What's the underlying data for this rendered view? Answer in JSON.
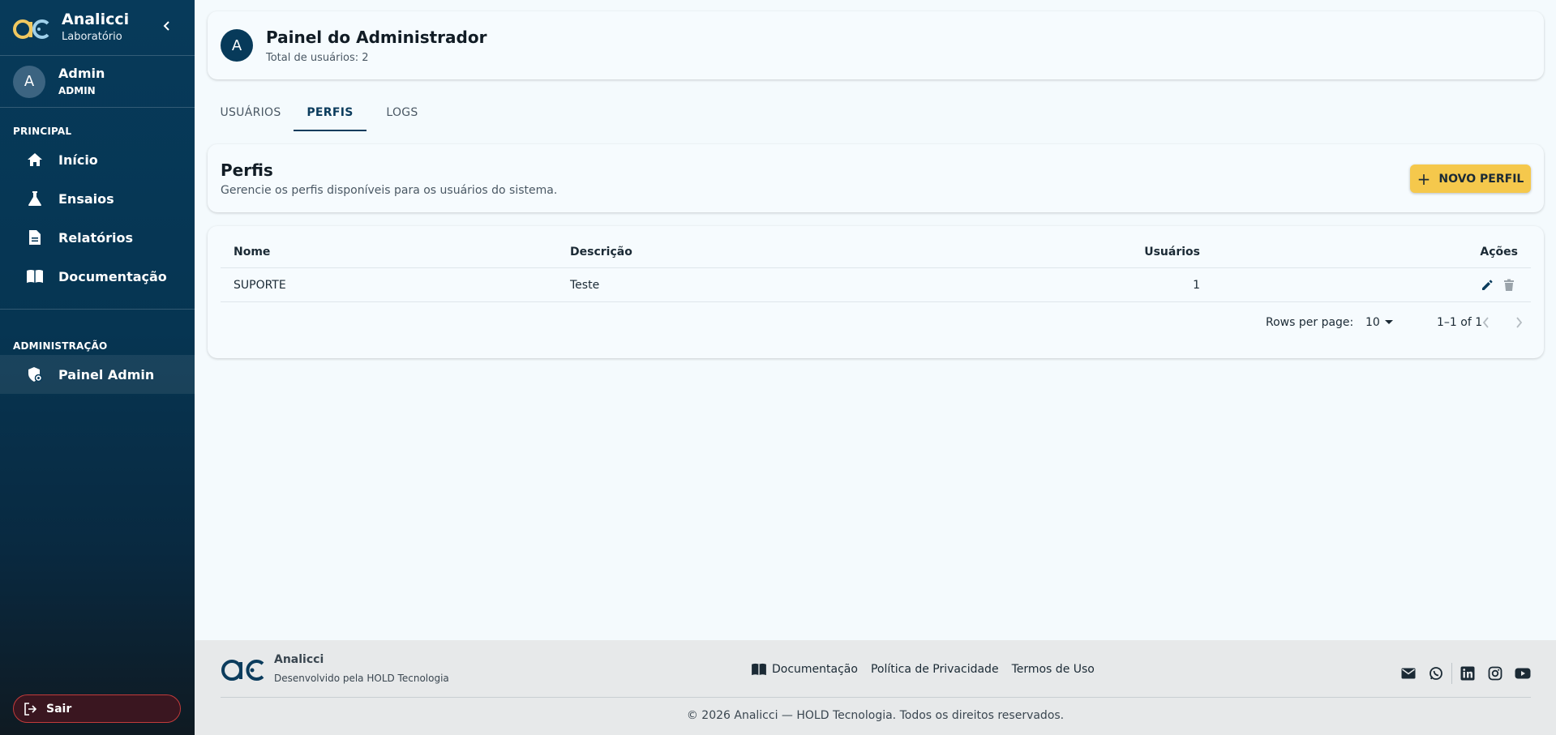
{
  "sidebar": {
    "brand_name": "Analicci",
    "brand_sub": "Laboratório",
    "user": {
      "initial": "A",
      "name": "Admin",
      "role": "ADMIN"
    },
    "section_principal": "PRINCIPAL",
    "items": [
      {
        "label": "Início",
        "icon": "home-icon"
      },
      {
        "label": "Ensaios",
        "icon": "flask-icon"
      },
      {
        "label": "Relatórios",
        "icon": "document-icon"
      },
      {
        "label": "Documentação",
        "icon": "book-icon"
      }
    ],
    "section_admin": "ADMINISTRAÇÃO",
    "admin_item": {
      "label": "Painel Admin",
      "icon": "admin-shield-icon"
    },
    "logout_label": "Sair"
  },
  "header": {
    "initial": "A",
    "title": "Painel do Administrador",
    "subtitle": "Total de usuários: 2"
  },
  "tabs": [
    {
      "label": "USUÁRIOS",
      "active": false
    },
    {
      "label": "PERFIS",
      "active": true
    },
    {
      "label": "LOGS",
      "active": false
    }
  ],
  "section": {
    "title": "Perfis",
    "subtitle": "Gerencie os perfis disponíveis para os usuários do sistema.",
    "new_button": "NOVO PERFIL"
  },
  "table": {
    "columns": {
      "name": "Nome",
      "description": "Descrição",
      "users": "Usuários",
      "actions": "Ações"
    },
    "rows": [
      {
        "name": "SUPORTE",
        "description": "Teste",
        "users": "1"
      }
    ],
    "pagination": {
      "rows_per_page_label": "Rows per page:",
      "rows_per_page": "10",
      "range": "1–1 of 1"
    }
  },
  "footer": {
    "brand_name": "Analicci",
    "developed_by": "Desenvolvido pela HOLD Tecnologia",
    "links": [
      "Documentação",
      "Política de Privacidade",
      "Termos de Uso"
    ],
    "social": [
      "mail-icon",
      "whatsapp-icon",
      "linkedin-icon",
      "instagram-icon",
      "youtube-icon"
    ],
    "copyright": "© 2026 Analicci — HOLD Tecnologia. Todos os direitos reservados."
  },
  "colors": {
    "sidebar": "#073a5a",
    "accent_button": "#f5c84c",
    "tab_active": "#0b3c5d",
    "logout_border": "#c23b3b"
  }
}
